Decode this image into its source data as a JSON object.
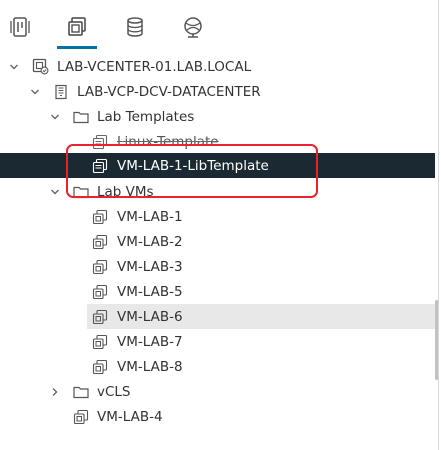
{
  "tabs": [
    {
      "icon": "hosts-clusters-icon",
      "active": false
    },
    {
      "icon": "vms-templates-icon",
      "active": true
    },
    {
      "icon": "storage-icon",
      "active": false
    },
    {
      "icon": "networking-icon",
      "active": false
    }
  ],
  "tree": {
    "vcenter": "LAB-VCENTER-01.LAB.LOCAL",
    "datacenter": "LAB-VCP-DCV-DATACENTER",
    "folder_templates": "Lab Templates",
    "template_linux": "Linux-Template",
    "template_lib": "VM-LAB-1-LibTemplate",
    "folder_vms": "Lab VMs",
    "vms": [
      "VM-LAB-1",
      "VM-LAB-2",
      "VM-LAB-3",
      "VM-LAB-5",
      "VM-LAB-6",
      "VM-LAB-7",
      "VM-LAB-8"
    ],
    "folder_vcls": "vCLS",
    "vm_root": "VM-LAB-4"
  },
  "colors": {
    "accent": "#0072a3",
    "selected_bg": "#1b2a32",
    "highlight": "#e8232b",
    "hover_bg": "#e8e8e8"
  }
}
